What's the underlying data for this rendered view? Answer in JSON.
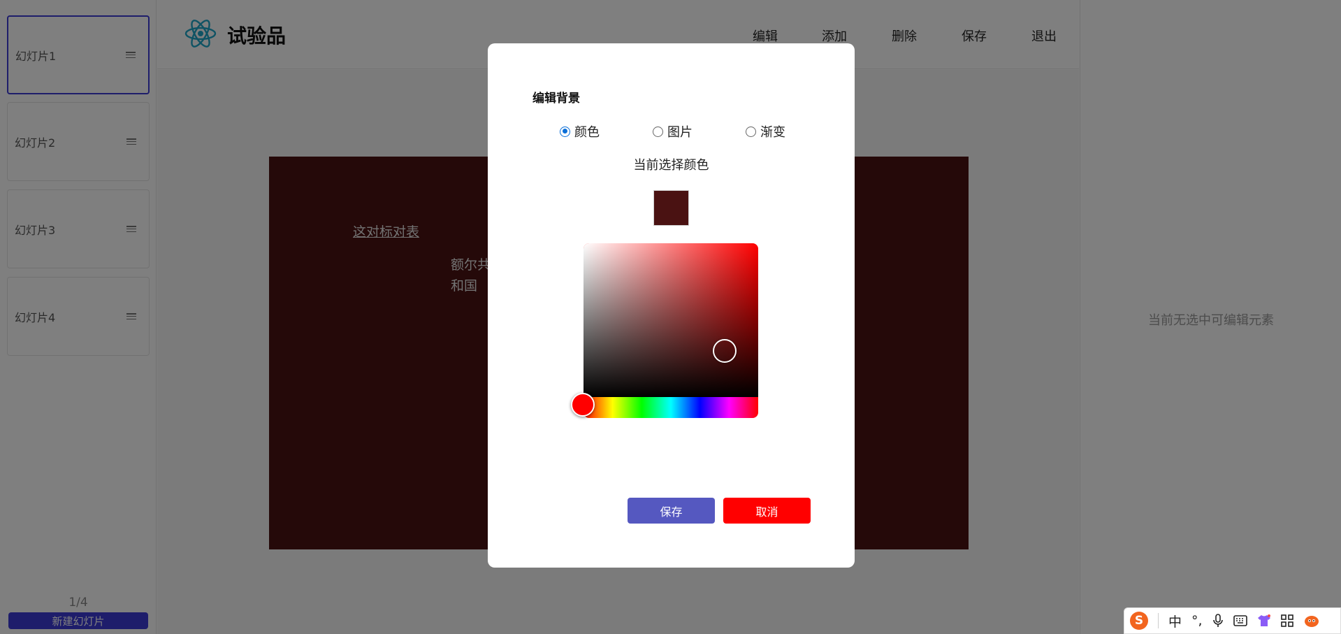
{
  "sidebar": {
    "slides": [
      {
        "label": "幻灯片1"
      },
      {
        "label": "幻灯片2"
      },
      {
        "label": "幻灯片3"
      },
      {
        "label": "幻灯片4"
      }
    ],
    "page_indicator": "1/4",
    "new_slide_label": "新建幻灯片"
  },
  "header": {
    "title": "试验品",
    "menu": [
      "编辑",
      "添加",
      "删除",
      "保存",
      "退出"
    ]
  },
  "slide": {
    "title_text": "这对标对表",
    "body_text": "额尔共和国",
    "background_color": "#4a1212"
  },
  "right_panel": {
    "empty_hint": "当前无选中可编辑元素"
  },
  "dialog": {
    "title": "编辑背景",
    "options": [
      {
        "label": "颜色",
        "checked": true
      },
      {
        "label": "图片",
        "checked": false
      },
      {
        "label": "渐变",
        "checked": false
      }
    ],
    "current_color_label": "当前选择颜色",
    "selected_color": "#4a1212",
    "hue_color": "#ff0000",
    "save_label": "保存",
    "cancel_label": "取消",
    "save_color": "#5558c0",
    "cancel_color": "#ff0000"
  },
  "ime": {
    "logo": "S",
    "mode": "中",
    "punct": "°,",
    "icons": [
      "mic-icon",
      "keyboard-icon",
      "shirt-icon",
      "grid-icon",
      "mascot-icon"
    ]
  },
  "colors": {
    "accent": "#3d3bd6",
    "overlay": "rgba(0,0,0,0.5)"
  }
}
